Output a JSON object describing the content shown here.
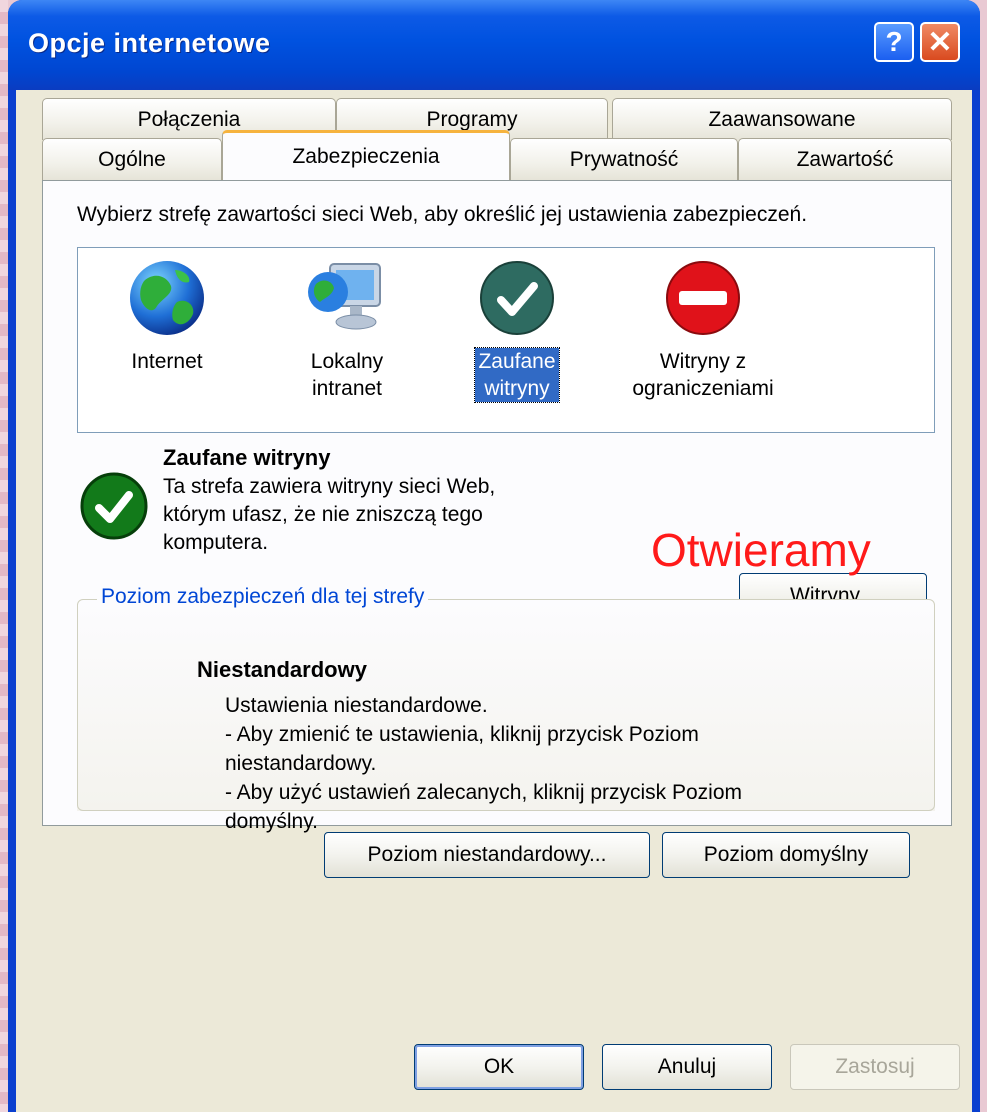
{
  "window": {
    "title": "Opcje internetowe",
    "help_label": "?",
    "close_label": "✕"
  },
  "tabs": {
    "row1": [
      "Połączenia",
      "Programy",
      "Zaawansowane"
    ],
    "row2": [
      "Ogólne",
      "Zabezpieczenia",
      "Prywatność",
      "Zawartość"
    ],
    "active": "Zabezpieczenia"
  },
  "zones": {
    "prompt": "Wybierz strefę zawartości sieci Web, aby określić jej ustawienia zabezpieczeń.",
    "items": [
      {
        "label": "Internet",
        "icon": "globe-icon"
      },
      {
        "label": "Lokalny\nintranet",
        "icon": "computer-globe-icon"
      },
      {
        "label": "Zaufane\nwitryny",
        "icon": "green-check-icon",
        "selected": true
      },
      {
        "label": "Witryny z\nograniczeniami",
        "icon": "red-no-entry-icon"
      }
    ]
  },
  "selected_zone": {
    "heading": "Zaufane witryny",
    "description": "Ta strefa zawiera witryny sieci Web,\nktórym ufasz, że nie zniszczą tego\nkomputera.",
    "sites_button": "Witryny..."
  },
  "annotation": {
    "text": "Otwieramy",
    "color": "#ff1a1a"
  },
  "security_level": {
    "group_title": "Poziom zabezpieczeń dla tej strefy",
    "level_name": "Niestandardowy",
    "description": "Ustawienia niestandardowe.\n- Aby zmienić te ustawienia, kliknij przycisk Poziom\nniestandardowy.\n- Aby użyć ustawień zalecanych, kliknij przycisk Poziom\ndomyślny.",
    "custom_level_button": "Poziom niestandardowy...",
    "default_level_button": "Poziom domyślny"
  },
  "footer": {
    "ok": "OK",
    "cancel": "Anuluj",
    "apply": "Zastosuj"
  },
  "colors": {
    "titlebar": "#0052e0",
    "selection": "#316ac5",
    "active_tab_accent": "#f6b33e",
    "link_blue": "#0046d5"
  }
}
